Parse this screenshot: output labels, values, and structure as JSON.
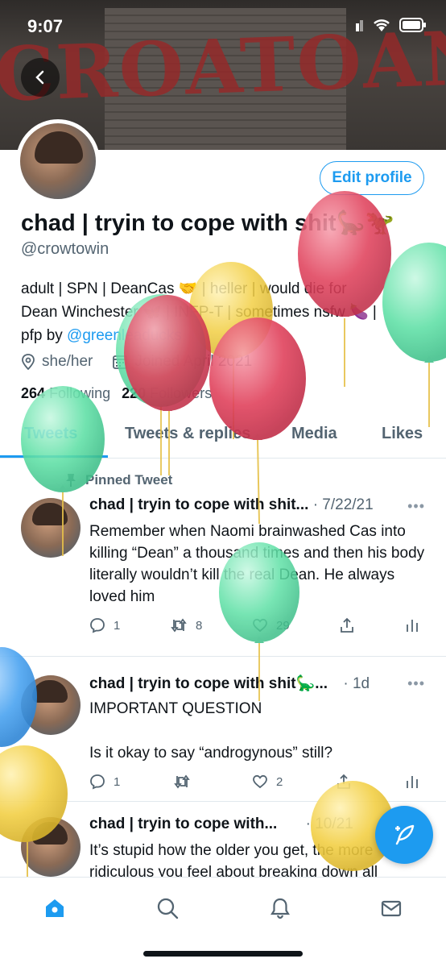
{
  "status": {
    "time": "9:07"
  },
  "banner": {
    "graffiti": "CROATOAN"
  },
  "profile": {
    "edit_label": "Edit profile",
    "display_name": "chad | tryin to cope with shit🦕🦖",
    "handle": "@crowtowin",
    "bio_line1": "adult | SPN | DeanCas 🤝 | heller | would die for",
    "bio_line2": "Dean Winchester 🦋 | INFP-T | sometimes nsfw 🍆 |",
    "bio_line3_prefix": "pfp by ",
    "bio_link": "@greenleaducks",
    "pronouns": "she/her",
    "joined": "Joined April 2021",
    "following_count": "264",
    "following_label": "Following",
    "followers_count": "220",
    "followers_label": "Followers"
  },
  "tabs": [
    "Tweets",
    "Tweets & replies",
    "Media",
    "Likes"
  ],
  "pinned_label": "Pinned Tweet",
  "tweets": [
    {
      "name": "chad | tryin to cope with shit...",
      "date": "· 7/22/21",
      "body": "Remember when Naomi brainwashed Cas into killing “Dean” a thousand times and then his body literally wouldn’t kill the real Dean. He always loved him",
      "replies": "1",
      "retweets": "8",
      "likes": "29"
    },
    {
      "name": "chad | tryin to cope with shit🦕...",
      "date": "· 1d",
      "body_line1": "IMPORTANT QUESTION",
      "body_line2": "Is it okay to say “androgynous” still?",
      "replies": "1",
      "retweets": "",
      "likes": "2"
    },
    {
      "name": "chad | tryin to cope with...",
      "date": "· 10/21",
      "body": "It’s stupid how the older you get, the more ridiculous you feel about breaking down all"
    }
  ],
  "colors": {
    "accent": "#1d9bf0",
    "balloon_red": "#e0425c",
    "balloon_green": "#5fe0a6",
    "balloon_yellow": "#f2cf45",
    "balloon_blue": "#4aa3f0"
  }
}
